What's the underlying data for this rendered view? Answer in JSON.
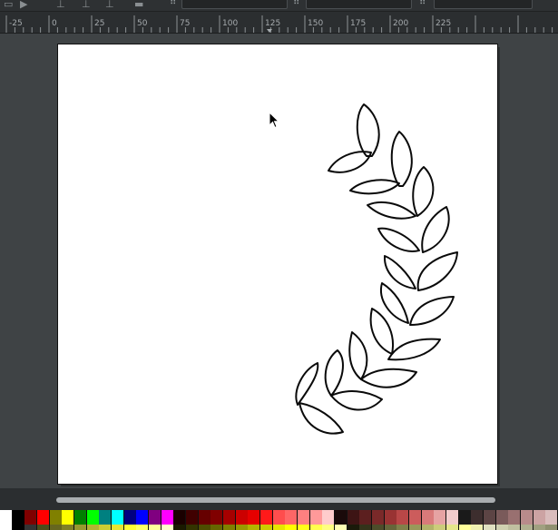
{
  "ruler": {
    "labels": [
      "-25",
      "0",
      "25",
      "50",
      "75",
      "100",
      "125",
      "150",
      "175",
      "200",
      "225"
    ]
  },
  "palette": {
    "row1": [
      "#ffffff",
      "#000000",
      "#800000",
      "#ff0000",
      "#808000",
      "#ffff00",
      "#008000",
      "#00ff00",
      "#008080",
      "#00ffff",
      "#000080",
      "#0000ff",
      "#800080",
      "#ff00ff",
      "#1a0000",
      "#400000",
      "#660000",
      "#800000",
      "#a60000",
      "#cc0000",
      "#e60000",
      "#ff1a1a",
      "#ff4d4d",
      "#ff6666",
      "#ff8080",
      "#ff9999",
      "#ffcccc",
      "#1a0a0a",
      "#3d1414",
      "#5c1f1f",
      "#7a2929",
      "#993333",
      "#b84747",
      "#cc5c5c",
      "#d97a7a",
      "#e6a3a3",
      "#f2cccc",
      "#1a1a1a",
      "#3d2e2e",
      "#5c4444",
      "#7a5a5a",
      "#997070",
      "#b88b8b",
      "#cca3a3",
      "#d9bcbc"
    ],
    "row2": [
      "#ffffff",
      "#000000",
      "#333333",
      "#4d4d1a",
      "#66661f",
      "#808026",
      "#99992e",
      "#b3b333",
      "#cccc33",
      "#e6e633",
      "#ffff33",
      "#ffff66",
      "#ffff99",
      "#ffffcc",
      "#1a1a00",
      "#333300",
      "#4d4d00",
      "#666600",
      "#808000",
      "#999900",
      "#b3b300",
      "#cccc00",
      "#e6e600",
      "#ffff00",
      "#ffff1a",
      "#ffff4d",
      "#ffff80",
      "#ffffb3",
      "#1a1a0a",
      "#33331a",
      "#4d4d2a",
      "#66663a",
      "#80804a",
      "#99995a",
      "#b3b36a",
      "#cccc7a",
      "#e6e68a",
      "#ffff9a",
      "#f0f0b0",
      "#e0e0c0",
      "#d0d0b0",
      "#c0c0a0",
      "#b0b090",
      "#a0a080",
      "#909070"
    ]
  }
}
